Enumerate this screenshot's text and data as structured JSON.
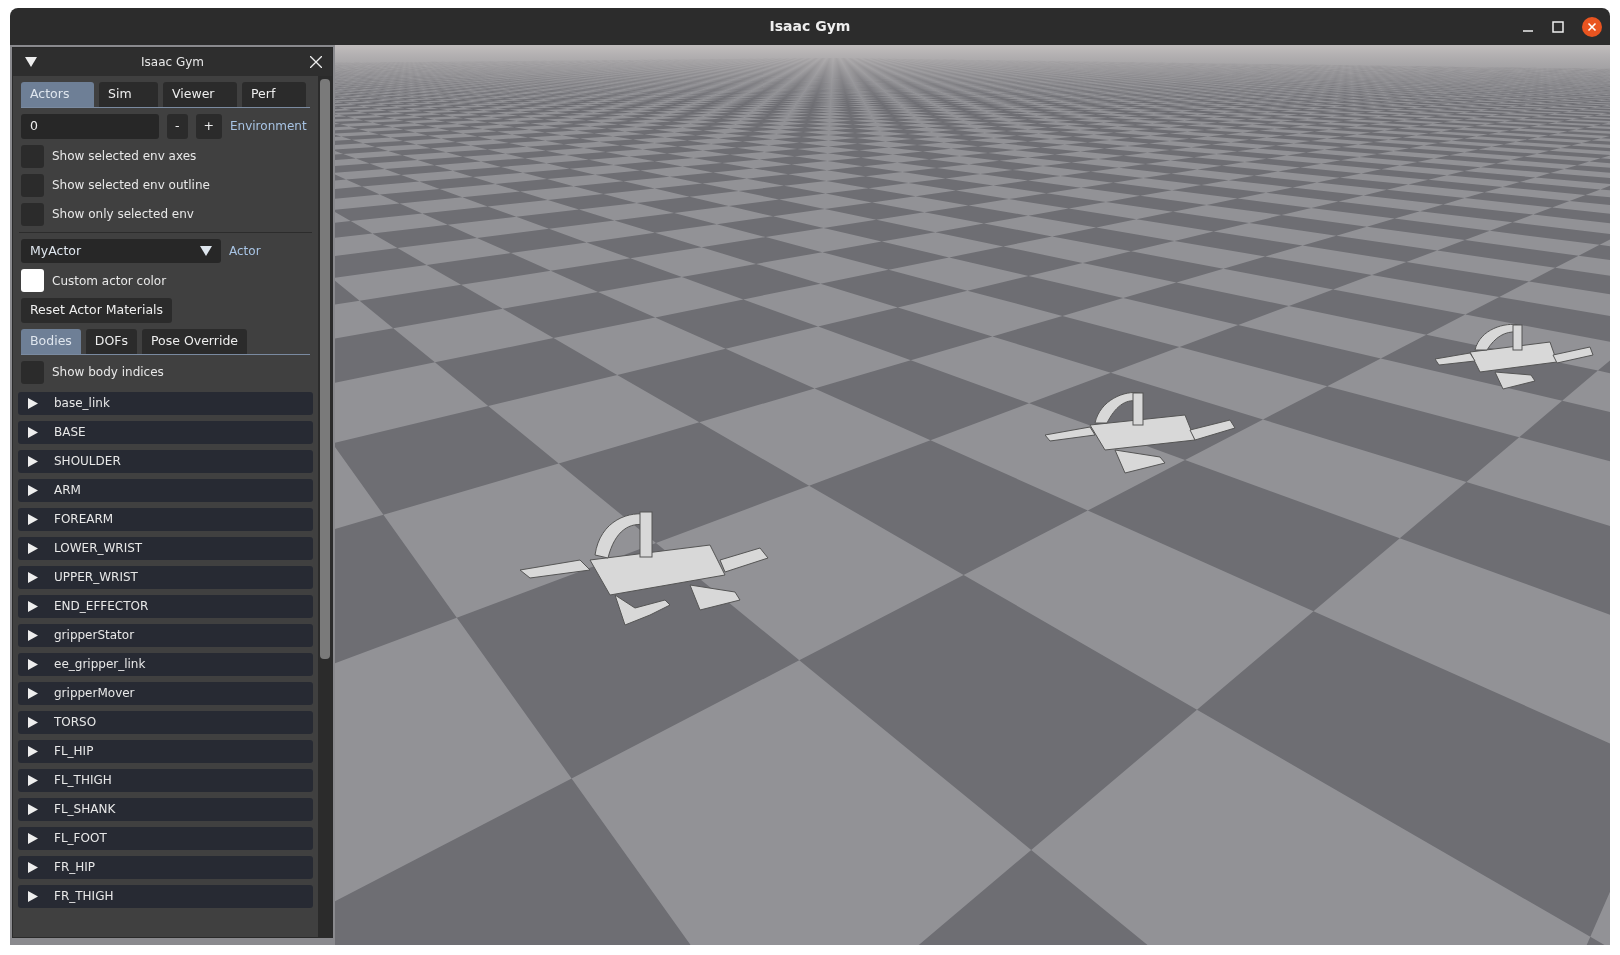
{
  "window": {
    "title": "Isaac Gym"
  },
  "panel": {
    "title": "Isaac Gym",
    "tabs": [
      {
        "label": "Actors",
        "selected": true
      },
      {
        "label": "Sim",
        "selected": false
      },
      {
        "label": "Viewer",
        "selected": false
      },
      {
        "label": "Perf",
        "selected": false
      }
    ],
    "env": {
      "value": "0",
      "minus": "-",
      "plus": "+",
      "label": "Environment"
    },
    "env_options": [
      {
        "label": "Show selected env axes",
        "checked": false
      },
      {
        "label": "Show selected env outline",
        "checked": false
      },
      {
        "label": "Show only selected env",
        "checked": false
      }
    ],
    "actor": {
      "value": "MyActor",
      "label": "Actor"
    },
    "custom_color": {
      "label": "Custom actor color",
      "color": "#ffffff"
    },
    "reset_button": "Reset Actor Materials",
    "subtabs": [
      {
        "label": "Bodies",
        "selected": true
      },
      {
        "label": "DOFs",
        "selected": false
      },
      {
        "label": "Pose Override",
        "selected": false
      }
    ],
    "body_indices": {
      "label": "Show body indices",
      "checked": false
    },
    "bodies": [
      {
        "name": "base_link",
        "expanded": false
      },
      {
        "name": "BASE",
        "expanded": false
      },
      {
        "name": "SHOULDER",
        "expanded": false
      },
      {
        "name": "ARM",
        "expanded": false
      },
      {
        "name": "FOREARM",
        "expanded": false
      },
      {
        "name": "LOWER_WRIST",
        "expanded": false
      },
      {
        "name": "UPPER_WRIST",
        "expanded": false
      },
      {
        "name": "END_EFFECTOR",
        "expanded": false
      },
      {
        "name": "gripperStator",
        "expanded": false
      },
      {
        "name": "ee_gripper_link",
        "expanded": false
      },
      {
        "name": "gripperMover",
        "expanded": false
      },
      {
        "name": "TORSO",
        "expanded": false
      },
      {
        "name": "FL_HIP",
        "expanded": false
      },
      {
        "name": "FL_THIGH",
        "expanded": false
      },
      {
        "name": "FL_SHANK",
        "expanded": false
      },
      {
        "name": "FL_FOOT",
        "expanded": false
      },
      {
        "name": "FR_HIP",
        "expanded": false
      },
      {
        "name": "FR_THIGH",
        "expanded": false
      }
    ]
  }
}
